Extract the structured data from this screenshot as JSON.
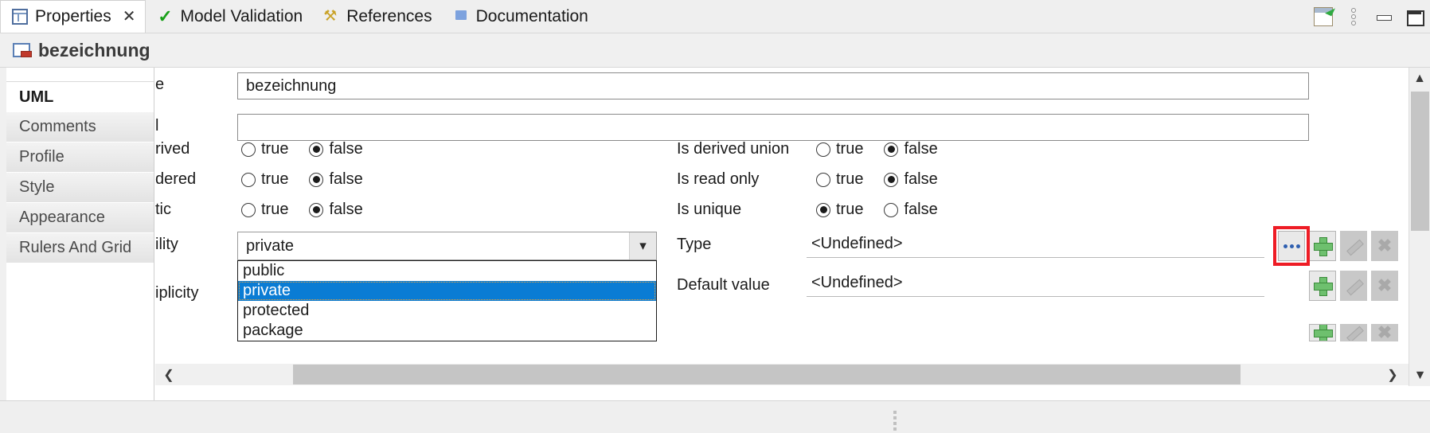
{
  "tabs": [
    {
      "label": "Properties",
      "icon": "properties-grid-icon",
      "active": true,
      "closable": true
    },
    {
      "label": "Model Validation",
      "icon": "green-check-icon",
      "active": false,
      "closable": false
    },
    {
      "label": "References",
      "icon": "references-tool-icon",
      "active": false,
      "closable": false
    },
    {
      "label": "Documentation",
      "icon": "book-icon",
      "active": false,
      "closable": false
    }
  ],
  "tab_close_glyph": "✕",
  "view_tools": [
    {
      "name": "new-view-icon",
      "title": "New View"
    },
    {
      "name": "view-menu-icon",
      "title": "View Menu"
    },
    {
      "name": "minimize-icon",
      "title": "Minimize"
    },
    {
      "name": "maximize-icon",
      "title": "Maximize"
    }
  ],
  "header": {
    "title": "bezeichnung",
    "icon": "property-element-icon"
  },
  "sidebar": {
    "items": [
      {
        "label": "UML",
        "selected": true
      },
      {
        "label": "Comments",
        "selected": false
      },
      {
        "label": "Profile",
        "selected": false
      },
      {
        "label": "Style",
        "selected": false
      },
      {
        "label": "Appearance",
        "selected": false
      },
      {
        "label": "Rulers And Grid",
        "selected": false
      }
    ]
  },
  "form": {
    "left_column": {
      "name": {
        "label": "e",
        "full_label": "Name",
        "value": "bezeichnung"
      },
      "label_field": {
        "label": "l",
        "full_label": "Label",
        "value": ""
      },
      "is_derived": {
        "label": "rived",
        "full_label": "Is derived",
        "true_label": "true",
        "false_label": "false",
        "selected": "false"
      },
      "is_ordered": {
        "label": "dered",
        "full_label": "Is ordered",
        "true_label": "true",
        "false_label": "false",
        "selected": "false"
      },
      "is_static": {
        "label": "tic",
        "full_label": "Is static",
        "true_label": "true",
        "false_label": "false",
        "selected": "false"
      },
      "visibility": {
        "label": "ility",
        "full_label": "Visibility",
        "value": "private",
        "expanded": true,
        "options": [
          "public",
          "private",
          "protected",
          "package"
        ],
        "highlighted_option": "private",
        "highlight_color": "#0a7cd4"
      },
      "multiplicity": {
        "label": "iplicity",
        "full_label": "Multiplicity"
      }
    },
    "right_column": {
      "is_derived_union": {
        "label": "Is derived union",
        "true_label": "true",
        "false_label": "false",
        "selected": "false"
      },
      "is_read_only": {
        "label": "Is read only",
        "true_label": "true",
        "false_label": "false",
        "selected": "false"
      },
      "is_unique": {
        "label": "Is unique",
        "true_label": "true",
        "false_label": "false",
        "selected": "true"
      },
      "type": {
        "label": "Type",
        "value": "<Undefined>"
      },
      "default_value": {
        "label": "Default value",
        "value": "<Undefined>"
      }
    },
    "buttons": {
      "browse": {
        "name": "browse-ellipsis-button",
        "glyph": "...",
        "enabled": true,
        "highlighted": true
      },
      "add": {
        "name": "add-button",
        "glyph": "+",
        "enabled": true
      },
      "edit": {
        "name": "edit-button",
        "glyph": "pencil",
        "enabled": false
      },
      "delete": {
        "name": "delete-button",
        "glyph": "✖",
        "enabled": false
      }
    },
    "highlight_color": "#ee1c25"
  },
  "scrollbars": {
    "vertical": {
      "up_glyph": "⌃",
      "down_glyph": "⌄"
    },
    "horizontal": {
      "left_glyph": "‹",
      "right_glyph": "›"
    }
  }
}
